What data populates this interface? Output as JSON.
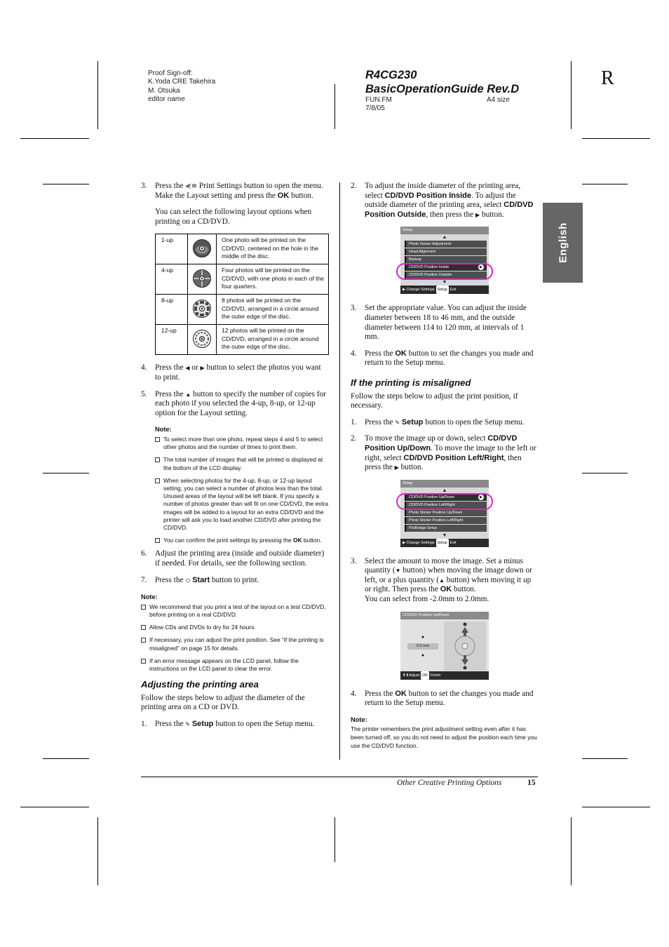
{
  "header": {
    "proof_lines": [
      "Proof Sign-off:",
      "K.Yoda CRE Takehira",
      "M. Otsuka",
      "editor name"
    ],
    "title_line1": "R4CG230",
    "title_line2": "BasicOperationGuide  Rev.D",
    "file": "FUN.FM",
    "date": "7/8/05",
    "size": "A4 size",
    "corner_letter": "R"
  },
  "side_tab": {
    "label": "English",
    "color": "#666666"
  },
  "left_column": {
    "step3": {
      "num": "3.",
      "text_a": "Press the ",
      "icon": "print-settings-icon",
      "text_b": " Print Settings button to open the menu. Make the Layout setting and press the ",
      "ok": "OK",
      "text_c": " button."
    },
    "layout_intro": "You can select the following layout options when printing on a CD/DVD.",
    "layout_table": [
      {
        "label": "1-up",
        "icon": "disc-1up-icon",
        "desc": "One photo will be printed on the CD/DVD, centered on the hole in the middle of the disc."
      },
      {
        "label": "4-up",
        "icon": "disc-4up-icon",
        "desc": "Four photos will be printed on the CD/DVD, with one photo in each of the four quarters."
      },
      {
        "label": "8-up",
        "icon": "disc-8up-icon",
        "desc": "8 photos will be printed on the CD/DVD, arranged in a circle around the outer edge of the disc."
      },
      {
        "label": "12-up",
        "icon": "disc-12up-icon",
        "desc": "12 photos will be printed on the CD/DVD, arranged in a circle around the outer edge of the disc."
      }
    ],
    "step4": {
      "num": "4.",
      "text_a": "Press the ",
      "left": "◀",
      "or": " or ",
      "right": "▶",
      "text_b": " button to select the photos you want to print."
    },
    "step5": {
      "num": "5.",
      "text_a": "Press the ",
      "up": "▲",
      "text_b": " button to specify the number of copies for each photo if you selected the 4-up, 8-up, or 12-up option for the Layout setting."
    },
    "note1": {
      "title": "Note:",
      "items": [
        "To select more than one photo, repeat steps 4 and 5 to select other photos and the number of times to print them.",
        "The total number of images that will be printed is displayed at the bottom of the LCD display.",
        "When selecting photos for the 4-up, 8-up, or 12-up layout setting, you can select a number of photos less than the total. Unused areas of the layout will be left blank. If you specify a number of photos greater than will fit on one CD/DVD, the extra images will be added to a layout for an extra CD/DVD and the printer will ask you to load another CD/DVD after printing the CD/DVD."
      ],
      "last_item_a": "You can confirm the print settings by pressing the ",
      "last_item_ok": "OK",
      "last_item_b": " button."
    },
    "step6": {
      "num": "6.",
      "text": "Adjust the printing area (inside and outside diameter) if needed. For details, see the following section."
    },
    "step7": {
      "num": "7.",
      "text_a": "Press the ",
      "icon": "◇",
      "start": "Start",
      "text_b": " button to print."
    },
    "note2": {
      "title": "Note:",
      "items": [
        "We recommend that you print a test of the layout on a test CD/DVD, before printing on a real CD/DVD.",
        "Allow CDs and DVDs to dry for 24 hours.",
        "If necessary, you can adjust the print position. See “If the printing is misaligned” on page 15 for details.",
        "If an error message appears on the LCD panel, follow the instructions on the LCD panel to clear the error."
      ]
    },
    "section_adjust": {
      "heading": "Adjusting the printing area",
      "intro": "Follow the steps below to adjust the diameter of the printing area on a CD or DVD.",
      "step1": {
        "num": "1.",
        "text_a": "Press the ",
        "icon": "✎",
        "setup": "Setup",
        "text_b": " button to open the Setup menu."
      }
    }
  },
  "right_column": {
    "step2": {
      "num": "2.",
      "text_a": "To adjust the inside diameter of the printing area, select ",
      "bold1": "CD/DVD Position Inside",
      "text_b": ". To adjust the outside diameter of the printing area, select ",
      "bold2": "CD/DVD Position Outside",
      "text_c": ", then press the ",
      "arrow": "▶",
      "text_d": " button."
    },
    "lcd1": {
      "title": "Setup",
      "items": [
        "Photo Viewer Adjustment",
        "Head Alignment",
        "Backup",
        "CD/DVD Position Inside",
        "CD/DVD Position Outside"
      ],
      "selected_index": 3,
      "footer_a": "Change Settings",
      "footer_key": "Setup",
      "footer_b": "Exit"
    },
    "step3": {
      "num": "3.",
      "text": "Set the appropriate value. You can adjust the inside diameter between 18 to 46 mm, and the outside diameter between 114 to 120 mm, at intervals of 1 mm."
    },
    "step4": {
      "num": "4.",
      "text_a": "Press the ",
      "ok": "OK",
      "text_b": " button to set the changes you made and return to the Setup menu."
    },
    "section_misaligned": {
      "heading": "If the printing is misaligned",
      "intro": "Follow the steps below to adjust the print position, if necessary.",
      "step1": {
        "num": "1.",
        "text_a": "Press the ",
        "icon": "✎",
        "setup": "Setup",
        "text_b": " button to open the Setup menu."
      },
      "step2": {
        "num": "2.",
        "text_a": "To move the image up or down, select ",
        "bold1": "CD/DVD Position Up/Down",
        "text_b": ". To move the image to the left or right, select ",
        "bold2": "CD/DVD Position Left/Right",
        "text_c": ", then press the ",
        "arrow": "▶",
        "text_d": " button."
      },
      "lcd2": {
        "title": "Setup",
        "items": [
          "CD/DVD Position Up/Down",
          "CD/DVD Position Left/Right",
          "Photo Sticker Position Up/Down",
          "Photo Sticker Position Left/Right",
          "PictBridge Setup"
        ],
        "selected_index": 0,
        "footer_a": "Change Settings",
        "footer_key": "Setup",
        "footer_b": "Exit"
      },
      "step3": {
        "num": "3.",
        "text_a": "Select the amount to move the image. Set a minus quantity (",
        "down": "▼",
        "text_b": " button) when moving the image down or left, or a plus quantity (",
        "up": "▲",
        "text_c": " button) when moving it up or right. Then press the ",
        "ok": "OK",
        "text_d": " button.",
        "range": "You can select from -2.0mm to 2.0mm."
      },
      "lcd3": {
        "title": "CD/DVD Position Up/Down",
        "value": "0.0 mm",
        "footer_a": "Adjust",
        "footer_key": "OK",
        "footer_b": "Finish"
      },
      "step4": {
        "num": "4.",
        "text_a": "Press the ",
        "ok": "OK",
        "text_b": " button to set the changes you made and return to the Setup menu."
      }
    },
    "note": {
      "title": "Note:",
      "text": "The printer remembers the print adjustment setting even after it has been turned off, so you do not need to adjust the position each time you use the CD/DVD function."
    }
  },
  "footer": {
    "chapter": "Other Creative Printing Options",
    "page": "15"
  },
  "colors": {
    "highlight_ring": "#e020d0",
    "lcd_item": "#4f4f4f"
  }
}
